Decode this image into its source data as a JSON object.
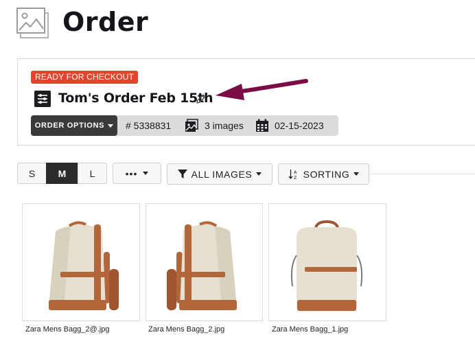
{
  "page": {
    "title": "Order"
  },
  "order": {
    "status": "READY FOR CHECKOUT",
    "name": "Tom's Order Feb 15th",
    "options_label": "ORDER OPTIONS",
    "number": "# 5338831",
    "image_count": "3 images",
    "date": "02-15-2023",
    "status_color": "#e0462c",
    "arrow_color": "#7a0d45"
  },
  "toolbar": {
    "sizes": [
      "S",
      "M",
      "L"
    ],
    "selected_size": "M",
    "more_label": "•••",
    "filter_label": "ALL IMAGES",
    "sort_label": "SORTING"
  },
  "images": [
    {
      "filename": "Zara Mens Bagg_2@.jpg"
    },
    {
      "filename": "Zara Mens Bagg_2.jpg"
    },
    {
      "filename": "Zara Mens Bagg_1.jpg"
    }
  ]
}
